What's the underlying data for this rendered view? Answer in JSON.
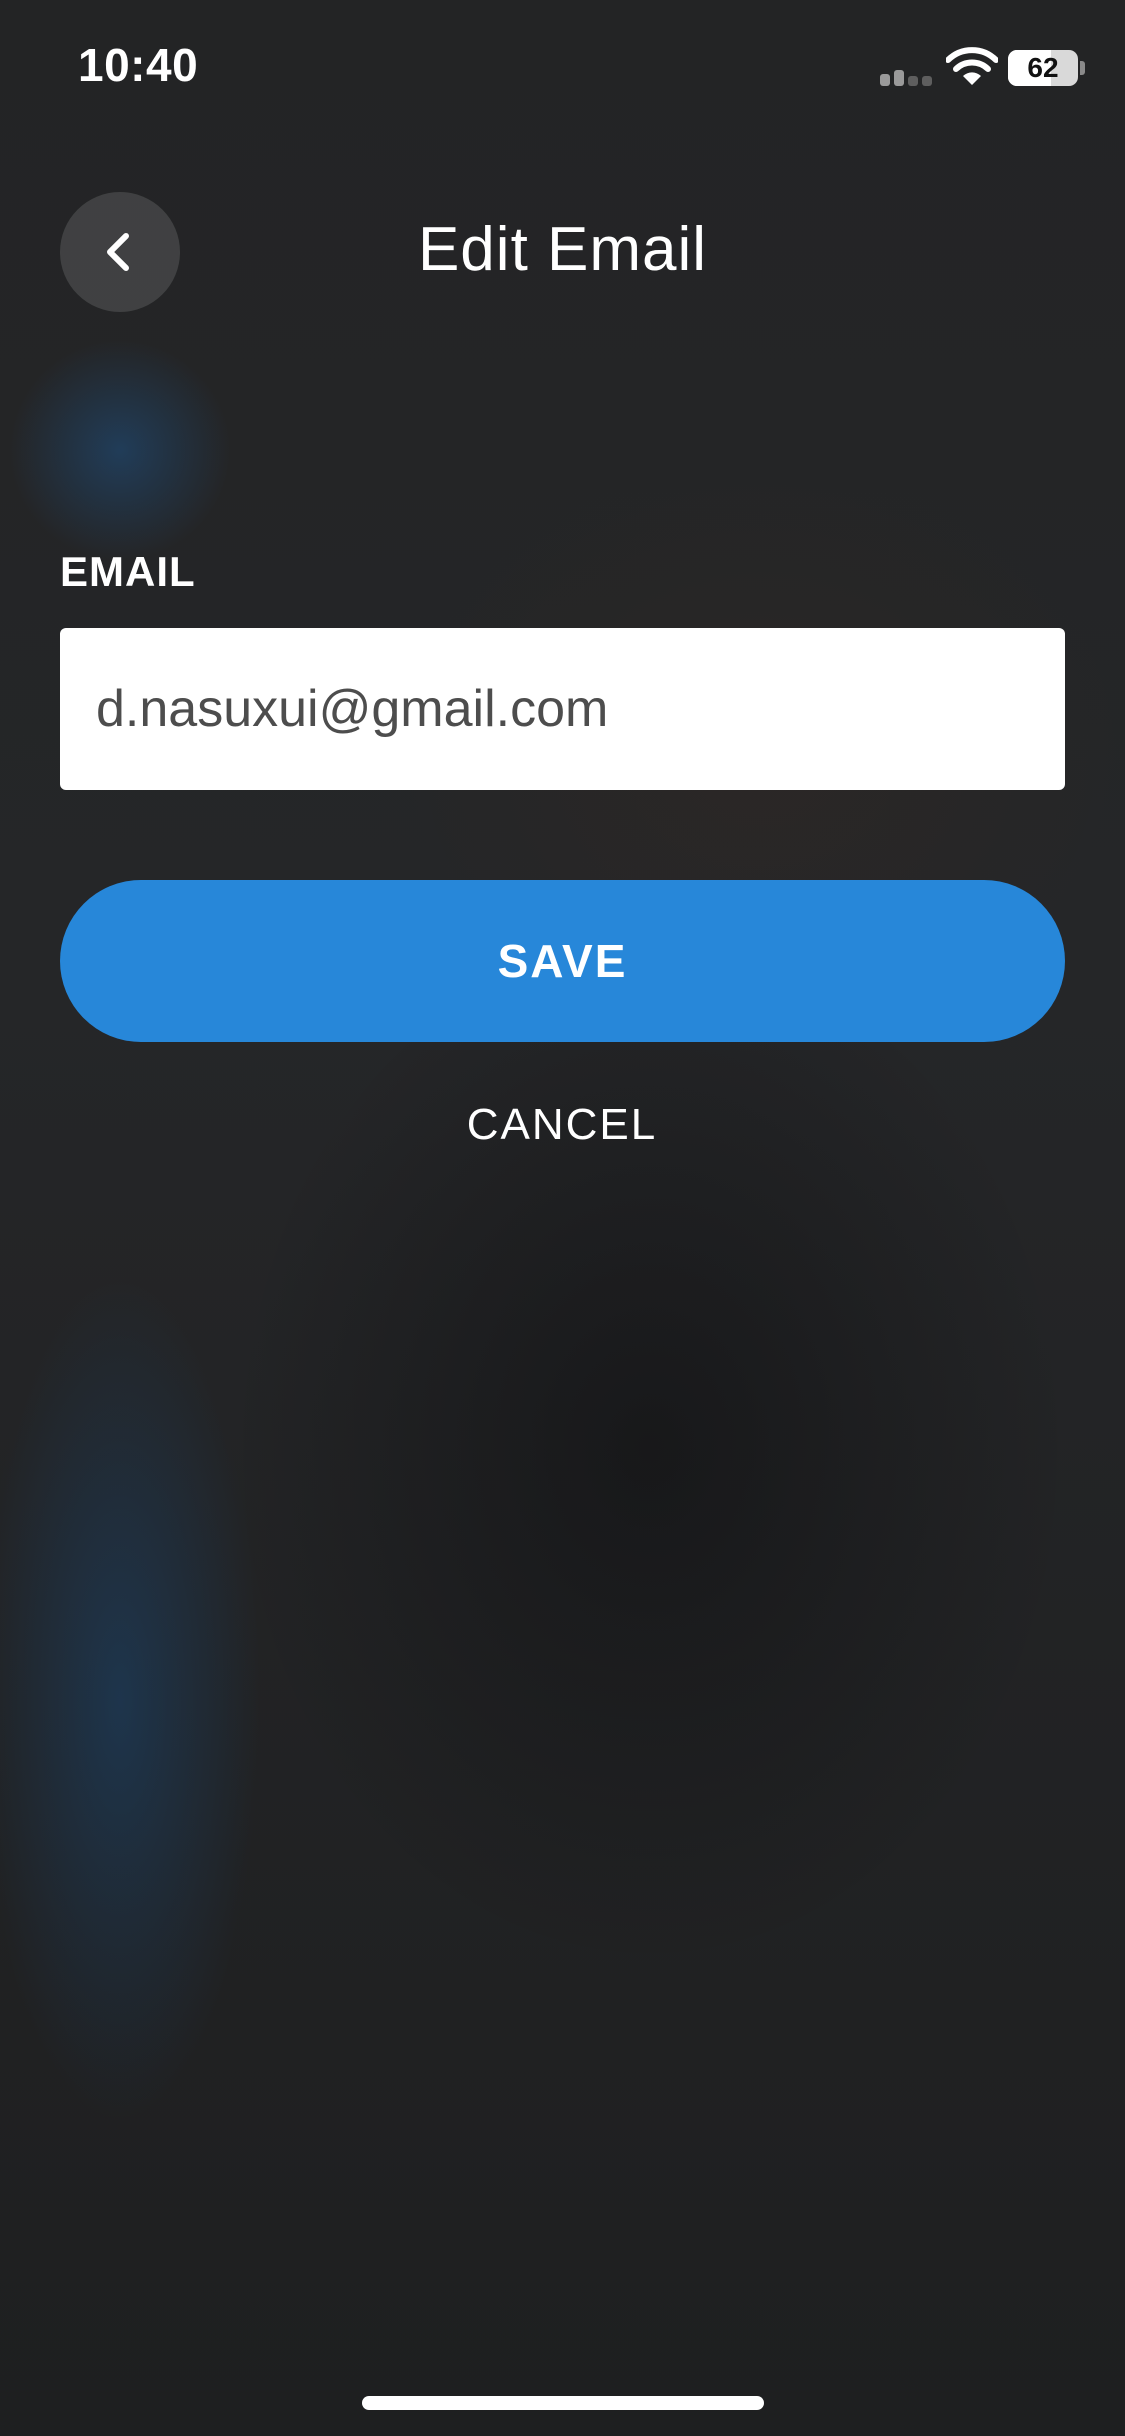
{
  "status_bar": {
    "time": "10:40",
    "battery_level": "62",
    "signal_icon": "cellular-signal-icon",
    "wifi_icon": "wifi-icon",
    "battery_icon": "battery-icon"
  },
  "header": {
    "title": "Edit Email",
    "back_icon": "chevron-left-icon"
  },
  "form": {
    "email_label": "EMAIL",
    "email_value": "d.nasuxui@gmail.com",
    "save_label": "SAVE",
    "cancel_label": "CANCEL"
  },
  "colors": {
    "accent": "#2787d9",
    "background": "#1f1f20",
    "input_background": "#ffffff",
    "text": "#ffffff"
  }
}
